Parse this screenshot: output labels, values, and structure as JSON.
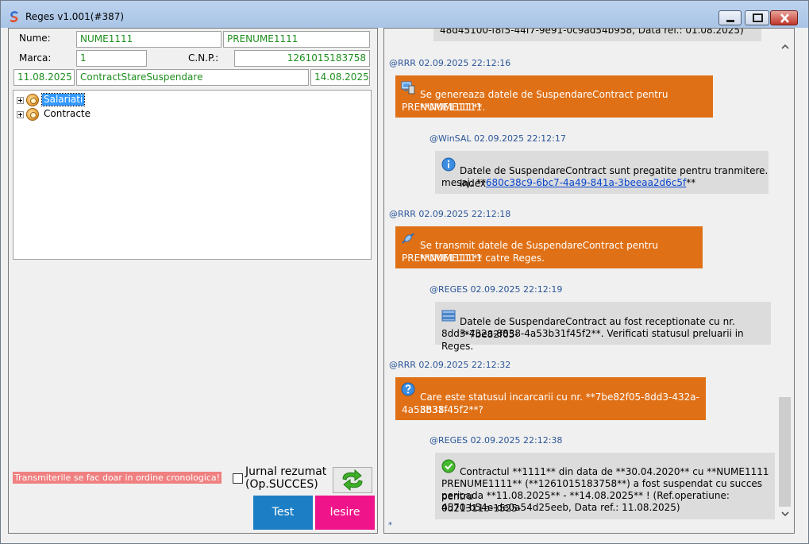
{
  "window": {
    "title": "Reges v1.001(#387)"
  },
  "form": {
    "nume_label": "Nume:",
    "nume_value": "NUME1111",
    "prenume_value": "PRENUME1111",
    "marca_label": "Marca:",
    "marca_value": "1",
    "cnp_label": "C.N.P.:",
    "cnp_value": "1261015183758",
    "date_start": "11.08.2025",
    "stare": "ContractStareSuspendare",
    "date_end": "14.08.2025"
  },
  "tree": {
    "items": [
      {
        "label": "Salariati",
        "selected": true
      },
      {
        "label": "Contracte",
        "selected": false
      }
    ]
  },
  "footer": {
    "warning": "Transmiterile se fac doar in ordine cronologica!",
    "jurnal_line1": "Jurnal rezumat",
    "jurnal_line2": "(Op.SUCCES)",
    "test_label": "Test",
    "iesire_label": "Iesire"
  },
  "chat": {
    "partial_top": "48d45100-f8f5-44f7-9e91-0c9ad54b958, Data ref.: 01.08.2025)",
    "messages": [
      {
        "stamp": "@RRR 02.09.2025 22:12:16",
        "icon": "computer-icon",
        "line1": "Se genereaza datele de SuspendareContract pentru **NUME1111",
        "line2": "PRENUME1111**."
      },
      {
        "stamp": "@WinSAL 02.09.2025 22:12:17",
        "icon": "info-icon",
        "line1": "Datele de SuspendareContract sunt pregatite pentru tranmitere. Index",
        "line2_prefix": "mesaj: **",
        "line2_link": "680c38c9-6bc7-4a49-841a-3beeaa2d6c5f",
        "line2_suffix": "**"
      },
      {
        "stamp": "@RRR 02.09.2025 22:12:18",
        "icon": "transmit-icon",
        "line1": "Se transmit datele de SuspendareContract pentru **NUME1111",
        "line2": "PRENUME1111** catre Reges."
      },
      {
        "stamp": "@REGES 02.09.2025 22:12:19",
        "icon": "server-icon",
        "line1": "Datele de SuspendareContract au fost receptionate cu nr. **7be82f05-",
        "line2": "8dd3-432a-8838-4a53b31f45f2**. Verificati statusul preluarii in Reges."
      },
      {
        "stamp": "@RRR 02.09.2025 22:12:32",
        "icon": "question-icon",
        "line1": "Care este statusul incarcarii cu nr. **7be82f05-8dd3-432a-8838-",
        "line2": "4a53b31f45f2**?"
      },
      {
        "stamp": "@REGES 02.09.2025 22:12:38",
        "icon": "success-icon",
        "line1": "Contractul **1111** din data de **30.04.2020** cu **NUME1111",
        "line2": "PRENUME1111** (**1261015183758**) a fost suspendat cu succes pentru",
        "line3": "perioada **11.08.2025** - **14.08.2025** ! (Ref.operatiune: 0d21311b-1525-",
        "line4": "4570-b54e-de0a54d25eeb, Data ref.: 11.08.2025)"
      }
    ],
    "end_mark": "*"
  }
}
